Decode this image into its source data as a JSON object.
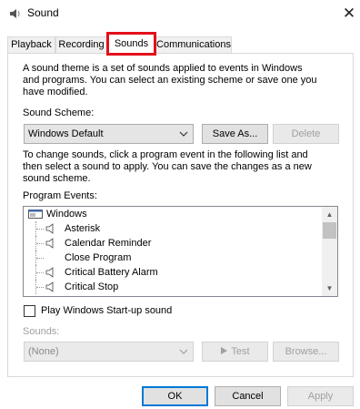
{
  "window": {
    "title": "Sound",
    "close_glyph": "✕"
  },
  "tabs": [
    {
      "label": "Playback"
    },
    {
      "label": "Recording"
    },
    {
      "label": "Sounds",
      "selected": true
    },
    {
      "label": "Communications"
    }
  ],
  "highlight_color": "#e3101b",
  "panel": {
    "intro": "A sound theme is a set of sounds applied to events in Windows\nand programs.  You can select an existing scheme or save one you\nhave modified.",
    "scheme_label": "Sound Scheme:",
    "scheme_value": "Windows Default",
    "save_as_label": "Save As...",
    "delete_label": "Delete",
    "change_text": "To change sounds, click a program event in the following list and\nthen select a sound to apply.  You can save the changes as a new\nsound scheme.",
    "events_label": "Program Events:",
    "events": [
      {
        "label": "Windows",
        "icon": "windows-group-icon"
      },
      {
        "label": "Asterisk",
        "icon": "speaker-icon"
      },
      {
        "label": "Calendar Reminder",
        "icon": "speaker-icon"
      },
      {
        "label": "Close Program",
        "icon": "none"
      },
      {
        "label": "Critical Battery Alarm",
        "icon": "speaker-icon"
      },
      {
        "label": "Critical Stop",
        "icon": "speaker-icon"
      }
    ],
    "startup_label": "Play Windows Start-up sound",
    "startup_checked": false,
    "sounds_label": "Sounds:",
    "sound_value": "(None)",
    "test_label": "Test",
    "browse_label": "Browse..."
  },
  "buttons": {
    "ok": "OK",
    "cancel": "Cancel",
    "apply": "Apply"
  }
}
